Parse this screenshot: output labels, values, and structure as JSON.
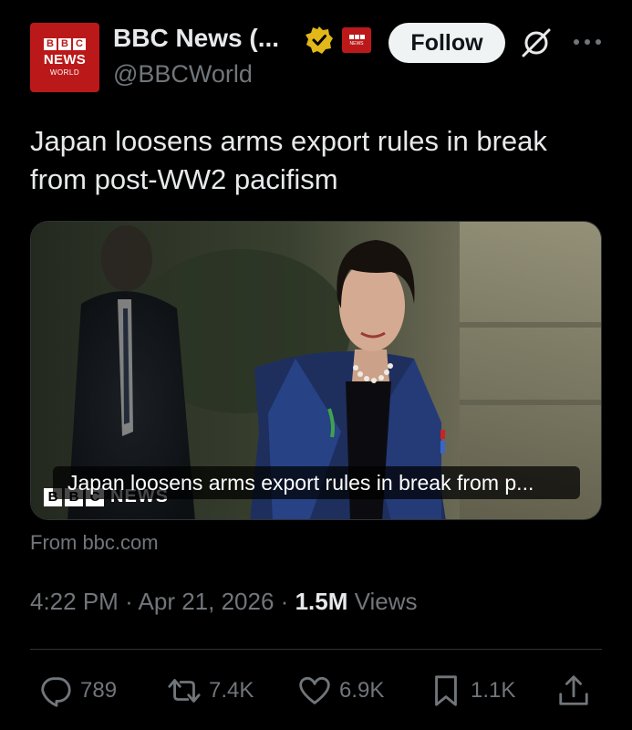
{
  "account": {
    "display_name": "BBC News (...",
    "handle": "@BBCWorld",
    "avatar_text": {
      "letters": [
        "B",
        "B",
        "C"
      ],
      "news": "NEWS",
      "world": "WORLD"
    },
    "affiliate_badge_text": "NEWS",
    "follow_label": "Follow"
  },
  "tweet": {
    "text": "Japan loosens arms export rules in break from post-WW2 pacifism"
  },
  "card": {
    "title": "Japan loosens arms export rules in break from p...",
    "logo_letters": [
      "B",
      "B",
      "C"
    ],
    "logo_word": "NEWS",
    "source": "From bbc.com"
  },
  "meta": {
    "time": "4:22 PM",
    "date": "Apr 21, 2026",
    "separator": "·",
    "views_count": "1.5M",
    "views_label": "Views"
  },
  "actions": {
    "replies": "789",
    "reposts": "7.4K",
    "likes": "6.9K",
    "bookmarks": "1.1K"
  },
  "colors": {
    "background": "#000000",
    "bbc_red": "#bb1919",
    "verified_gold": "#e2b719",
    "muted_text": "#71767b"
  }
}
